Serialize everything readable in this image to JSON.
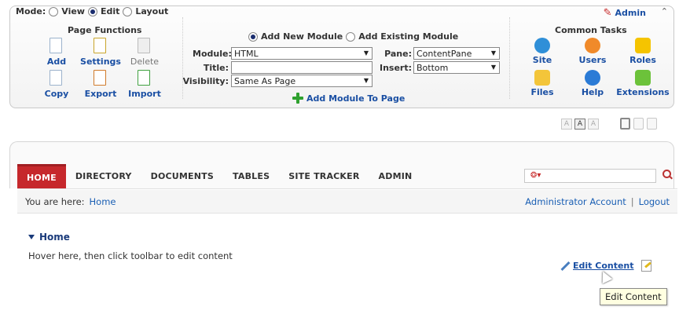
{
  "control_panel": {
    "mode_label": "Mode:",
    "modes": [
      {
        "label": "View",
        "selected": false
      },
      {
        "label": "Edit",
        "selected": true
      },
      {
        "label": "Layout",
        "selected": false
      }
    ],
    "admin_label": "Admin",
    "collapse_icon": "double-chevron-up-icon",
    "page_functions": {
      "heading": "Page Functions",
      "items": [
        {
          "label": "Add",
          "icon": "add-page-icon",
          "enabled": true
        },
        {
          "label": "Settings",
          "icon": "settings-page-icon",
          "enabled": true
        },
        {
          "label": "Delete",
          "icon": "delete-page-icon",
          "enabled": false
        },
        {
          "label": "Copy",
          "icon": "copy-page-icon",
          "enabled": true
        },
        {
          "label": "Export",
          "icon": "export-page-icon",
          "enabled": true
        },
        {
          "label": "Import",
          "icon": "import-page-icon",
          "enabled": true
        }
      ]
    },
    "add_module": {
      "options": [
        {
          "label": "Add New Module",
          "selected": true
        },
        {
          "label": "Add Existing Module",
          "selected": false
        }
      ],
      "module_label": "Module:",
      "module_value": "HTML",
      "title_label": "Title:",
      "title_value": "",
      "visibility_label": "Visibility:",
      "visibility_value": "Same As Page",
      "pane_label": "Pane:",
      "pane_value": "ContentPane",
      "insert_label": "Insert:",
      "insert_value": "Bottom",
      "add_button": "Add Module To Page"
    },
    "common_tasks": {
      "heading": "Common Tasks",
      "items": [
        {
          "label": "Site",
          "icon": "site-globe-icon",
          "color": "#2f8fd8"
        },
        {
          "label": "Users",
          "icon": "users-icon",
          "color": "#f08a2a"
        },
        {
          "label": "Roles",
          "icon": "lock-roles-icon",
          "color": "#f5c400"
        },
        {
          "label": "Files",
          "icon": "folder-icon",
          "color": "#f3c53a"
        },
        {
          "label": "Help",
          "icon": "help-icon",
          "color": "#2b7bd6"
        },
        {
          "label": "Extensions",
          "icon": "puzzle-extensions-icon",
          "color": "#6cc23a"
        }
      ]
    },
    "text_sizes": [
      "A",
      "A",
      "A"
    ],
    "active_text_size": 1
  },
  "nav": {
    "items": [
      "HOME",
      "DIRECTORY",
      "DOCUMENTS",
      "TABLES",
      "SITE TRACKER",
      "ADMIN"
    ],
    "active": 0,
    "accent": "#c6282c"
  },
  "breadcrumb": {
    "label": "You are here:",
    "link": "Home",
    "user": "Administrator Account",
    "separator": "|",
    "logout": "Logout"
  },
  "module": {
    "title": "Home",
    "text": "Hover here, then click toolbar to edit content",
    "edit_label": "Edit Content",
    "tooltip": "Edit Content"
  }
}
